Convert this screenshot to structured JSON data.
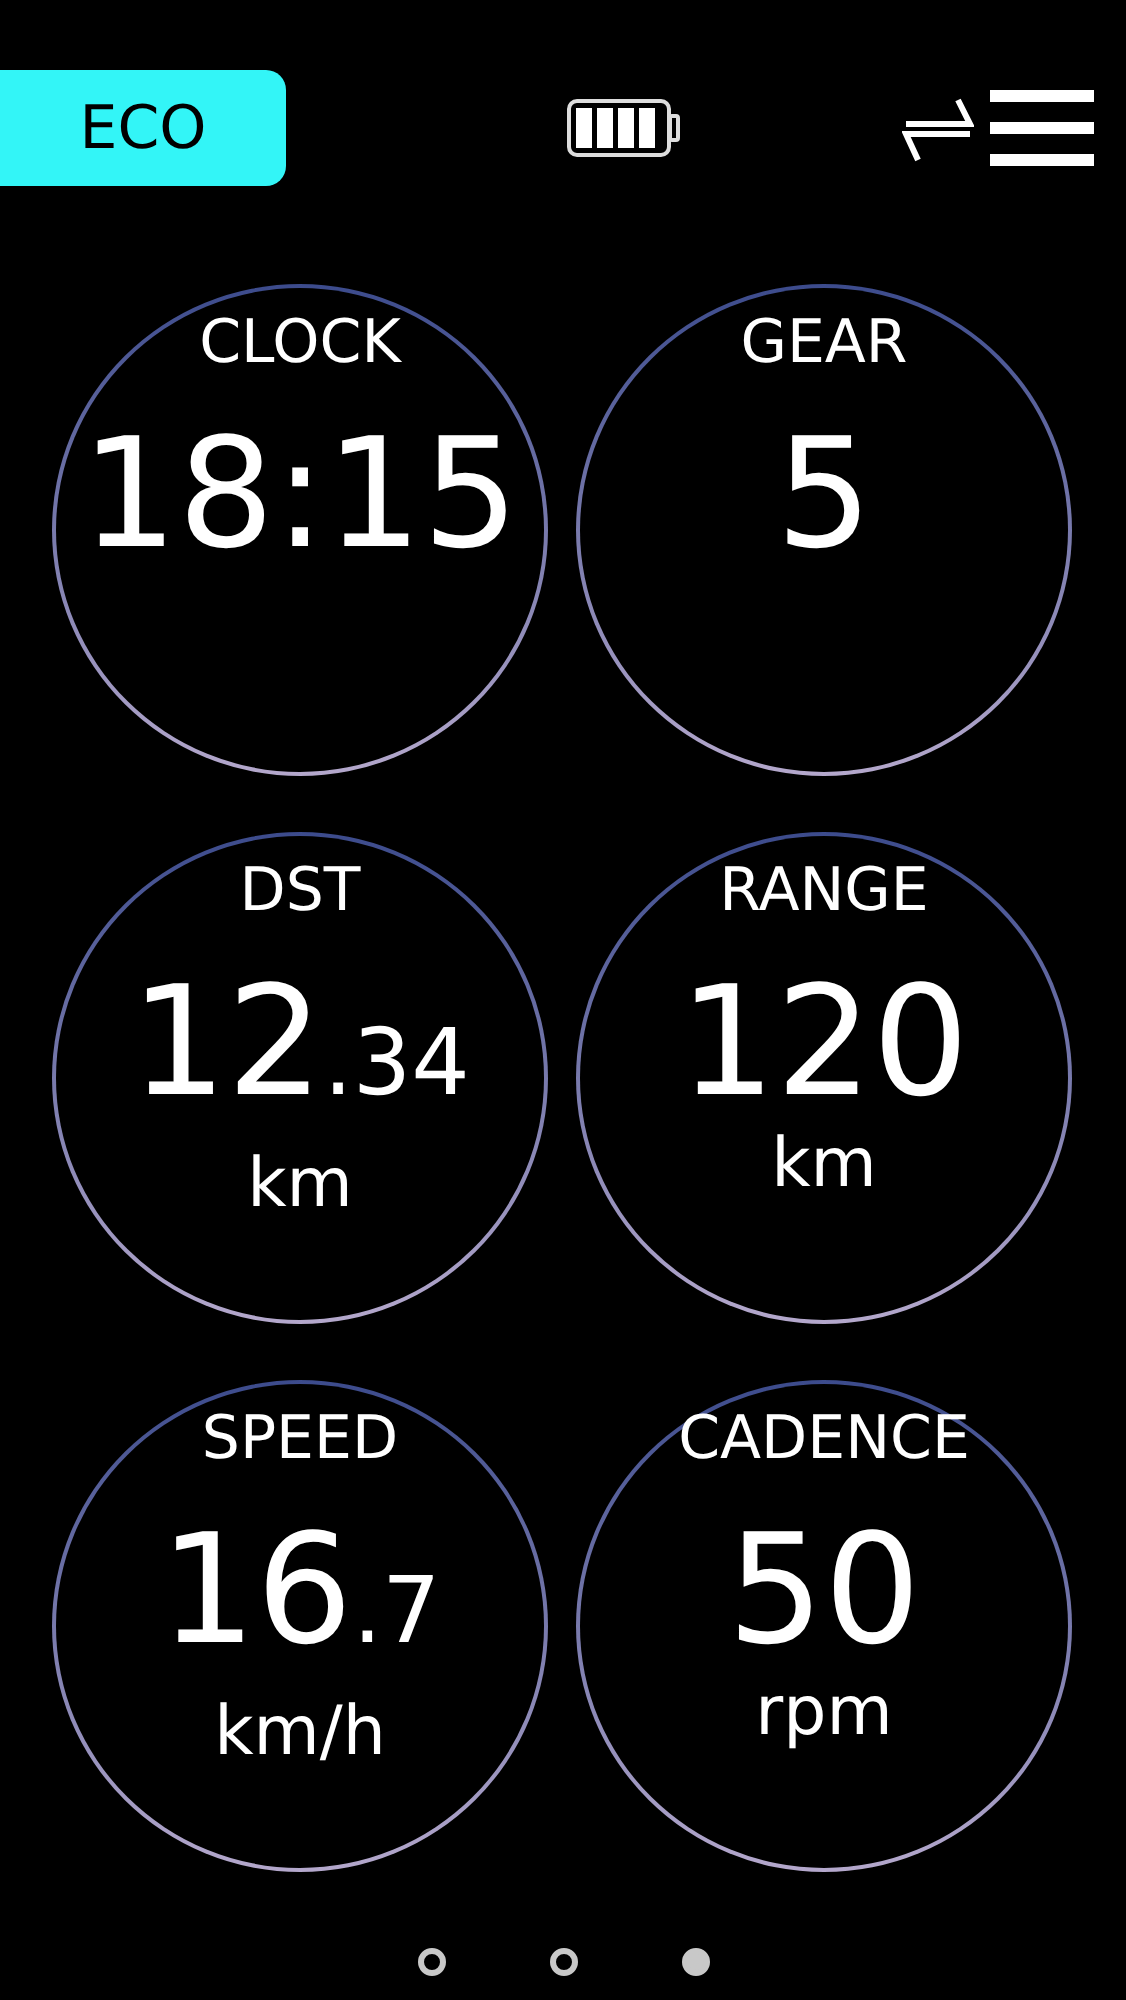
{
  "mode": {
    "label": "ECO"
  },
  "gauges": [
    {
      "label": "CLOCK",
      "value": "18:15"
    },
    {
      "label": "GEAR",
      "value": "5"
    },
    {
      "label": "DST",
      "value": "12",
      "decimals": ".34",
      "unit": "km"
    },
    {
      "label": "RANGE",
      "value": "120",
      "unit": "km"
    },
    {
      "label": "SPEED",
      "value": "16",
      "decimals": ".7",
      "unit": "km/h"
    },
    {
      "label": "CADENCE",
      "value": "50",
      "unit": "rpm"
    }
  ],
  "pages": [
    {
      "selected": false
    },
    {
      "selected": false
    },
    {
      "selected": true
    }
  ]
}
